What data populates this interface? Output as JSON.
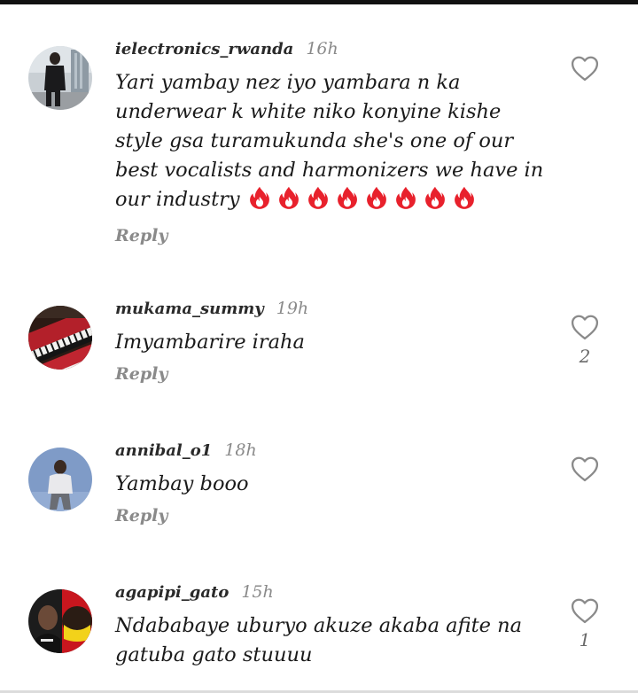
{
  "comments": [
    {
      "username": "ielectronics_rwanda",
      "time": "16h",
      "text": "Yari yambay nez iyo yambara n ka\nunderwear k white niko konyine kishe\nstyle gsa turamukunda she's one of our\nbest vocalists and harmonizers we have in\nour industry",
      "reactions": [
        "fire-emoji",
        "fire-emoji",
        "fire-emoji",
        "fire-emoji",
        "fire-emoji",
        "fire-emoji",
        "fire-emoji",
        "fire-emoji"
      ],
      "reply_label": "Reply",
      "like_count": ""
    },
    {
      "username": "mukama_summy",
      "time": "19h",
      "text": "Imyambarire iraha",
      "reply_label": "Reply",
      "like_count": "2"
    },
    {
      "username": "annibal_o1",
      "time": "18h",
      "text": "Yambay booo",
      "reply_label": "Reply",
      "like_count": ""
    },
    {
      "username": "agapipi_gato",
      "time": "15h",
      "text": "Ndababaye uburyo akuze akaba afite na\ngatuba gato stuuuu",
      "reply_label": "",
      "like_count": "1"
    }
  ],
  "icons": {
    "like": "heart-outline-icon",
    "reaction": "fire-emoji"
  },
  "colors": {
    "username": "#2a2a2a",
    "timestamp": "#8a8a8a",
    "text": "#1a1a1a",
    "fire": "#e8212c"
  }
}
